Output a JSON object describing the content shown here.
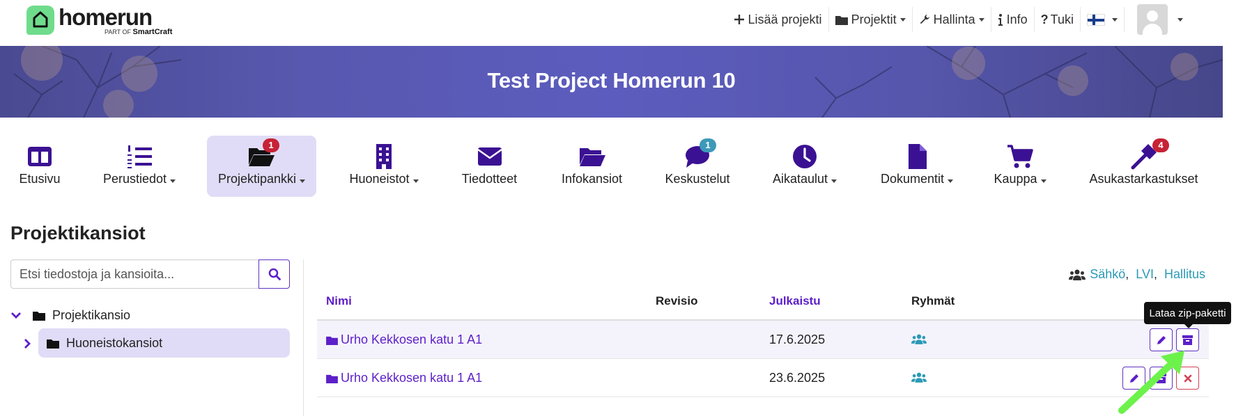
{
  "brand": {
    "name": "homerun",
    "sub_prefix": "PART OF",
    "sub_brand": "SmartCraft"
  },
  "topnav": {
    "add_project": "Lisää projekti",
    "projects": "Projektit",
    "admin": "Hallinta",
    "info": "Info",
    "support": "Tuki",
    "language_icon": "finland-flag-icon"
  },
  "banner": {
    "title": "Test Project Homerun 10"
  },
  "modules": [
    {
      "label": "Etusivu",
      "icon": "columns-icon",
      "dropdown": false
    },
    {
      "label": "Perustiedot",
      "icon": "list-ol-icon",
      "dropdown": true
    },
    {
      "label": "Projektipankki",
      "icon": "folder-open-icon",
      "dropdown": true,
      "badge": "1",
      "active": true
    },
    {
      "label": "Huoneistot",
      "icon": "building-icon",
      "dropdown": true
    },
    {
      "label": "Tiedotteet",
      "icon": "envelope-icon",
      "dropdown": false
    },
    {
      "label": "Infokansiot",
      "icon": "folder-open-icon",
      "dropdown": false
    },
    {
      "label": "Keskustelut",
      "icon": "comment-icon",
      "dropdown": false,
      "badge": "1"
    },
    {
      "label": "Aikataulut",
      "icon": "clock-icon",
      "dropdown": true
    },
    {
      "label": "Dokumentit",
      "icon": "file-icon",
      "dropdown": true
    },
    {
      "label": "Kauppa",
      "icon": "cart-icon",
      "dropdown": true
    },
    {
      "label": "Asukastarkastukset",
      "icon": "hammer-icon",
      "dropdown": false,
      "badge": "4"
    }
  ],
  "page": {
    "title": "Projektikansiot"
  },
  "search": {
    "placeholder": "Etsi tiedostoja ja kansioita..."
  },
  "tree": [
    {
      "label": "Projektikansio",
      "expanded": true
    },
    {
      "label": "Huoneistokansiot",
      "expanded": false,
      "selected": true
    }
  ],
  "groups": [
    "Sähkö",
    "LVI",
    "Hallitus"
  ],
  "table": {
    "headers": {
      "name": "Nimi",
      "revision": "Revisio",
      "published": "Julkaistu",
      "groups": "Ryhmät"
    },
    "rows": [
      {
        "name": "Urho Kekkosen katu 1 A1",
        "revision": "",
        "published": "17.6.2025"
      },
      {
        "name": "Urho Kekkosen katu 1 A1",
        "revision": "",
        "published": "23.6.2025"
      }
    ]
  },
  "tooltip": "Lataa zip-paketti",
  "colors": {
    "accent": "#5d1fc9",
    "teal": "#2a9ab5",
    "badge_red": "#c72236",
    "badge_teal": "#3d99b9",
    "active_bg": "#e0dcf7",
    "arrow": "#6cf24a"
  }
}
